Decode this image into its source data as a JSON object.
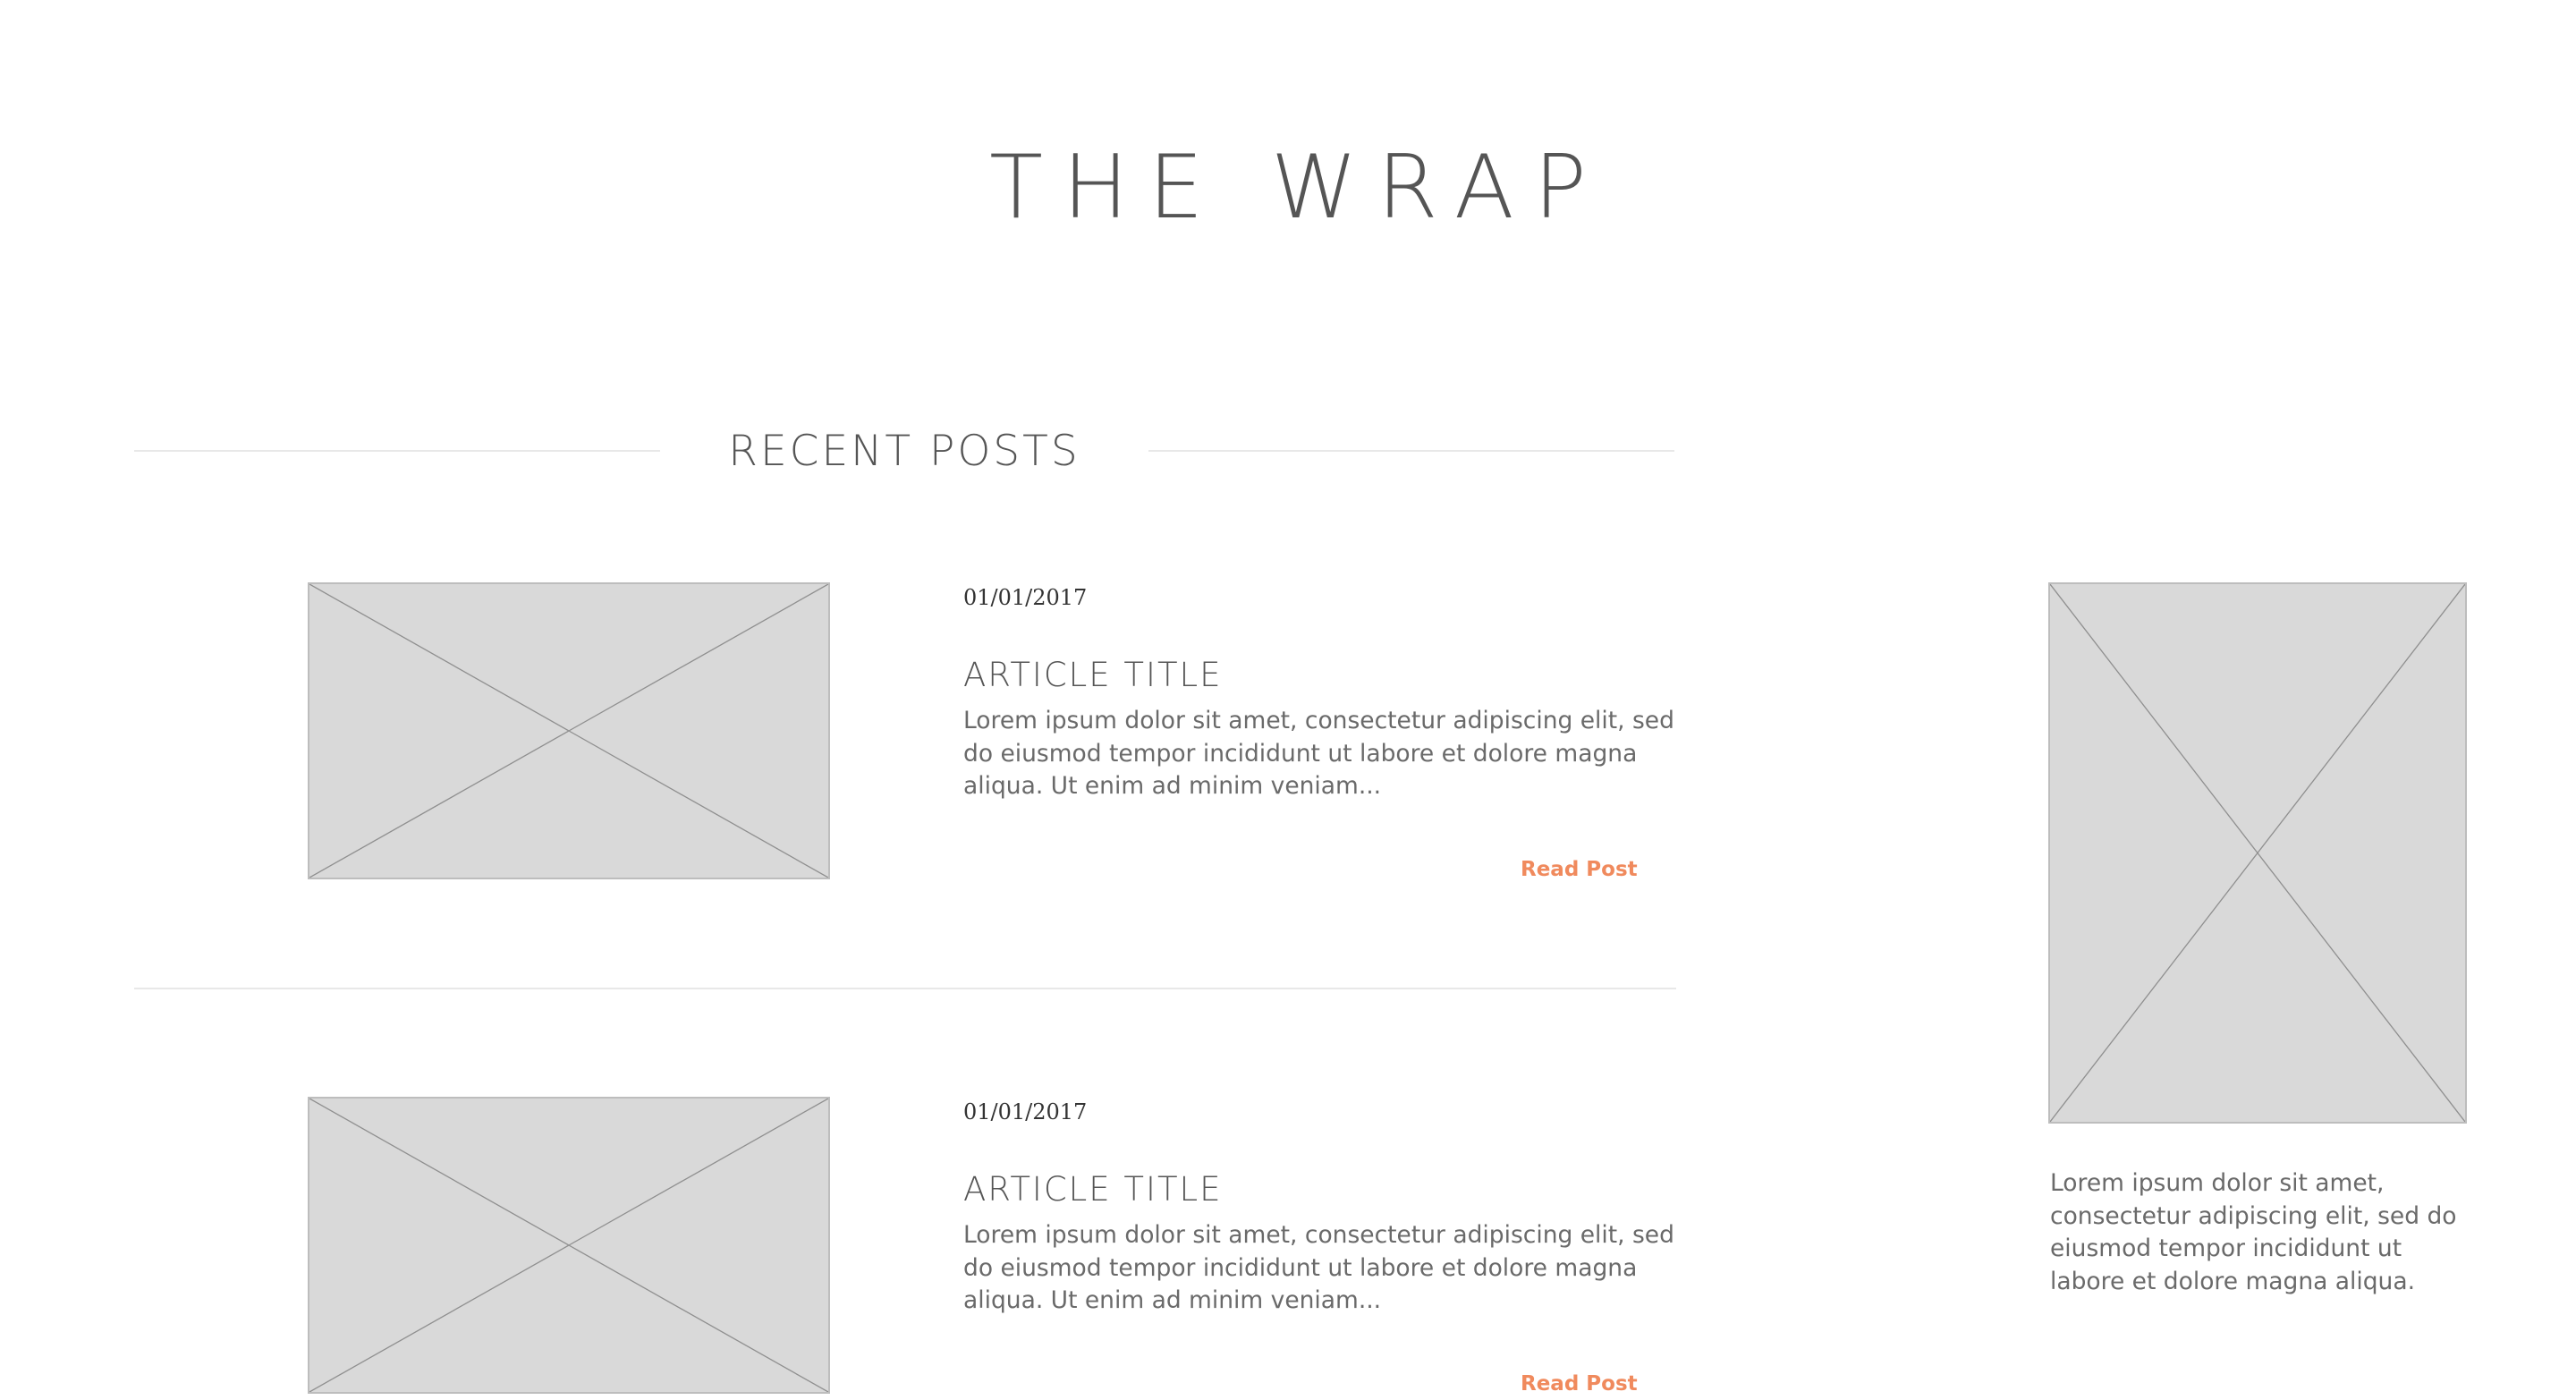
{
  "site": {
    "title": "THE WRAP"
  },
  "section": {
    "heading": "RECENT POSTS"
  },
  "posts": [
    {
      "date": "01/01/2017",
      "title": "ARTICLE TITLE",
      "excerpt": "Lorem ipsum dolor sit amet, consectetur adipiscing elit, sed do eiusmod tempor incididunt ut labore et dolore magna aliqua. Ut enim ad minim veniam...",
      "read_more": "Read Post"
    },
    {
      "date": "01/01/2017",
      "title": "ARTICLE TITLE",
      "excerpt": "Lorem ipsum dolor sit amet, consectetur adipiscing elit, sed do eiusmod tempor incididunt ut labore et dolore magna aliqua. Ut enim ad minim veniam...",
      "read_more": "Read Post"
    }
  ],
  "sidebar": {
    "text": "Lorem ipsum dolor sit amet, consectetur adipiscing elit, sed do eiusmod tempor incididunt ut labore et dolore magna aliqua."
  },
  "colors": {
    "accent": "#f08a5d",
    "placeholder_fill": "#d9d9d9",
    "text": "#555555",
    "rule": "#e8e8e8"
  }
}
